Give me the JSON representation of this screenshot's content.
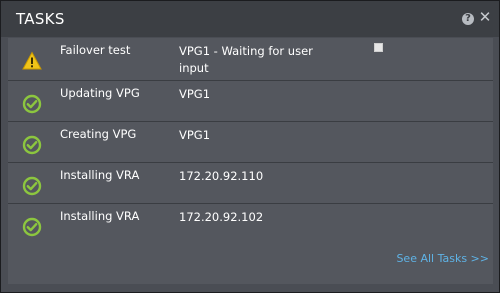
{
  "header": {
    "title": "TASKS",
    "help_icon": "?",
    "close_icon": "✕"
  },
  "tasks": [
    {
      "name": "Failover test",
      "target": "VPG1 - Waiting for user input",
      "status": "warning",
      "has_checkbox": true
    },
    {
      "name": "Updating VPG",
      "target": "VPG1",
      "status": "success"
    },
    {
      "name": "Creating VPG",
      "target": "VPG1",
      "status": "success"
    },
    {
      "name": "Installing VRA",
      "target": "172.20.92.110",
      "status": "success"
    },
    {
      "name": "Installing VRA",
      "target": "172.20.92.102",
      "status": "success"
    }
  ],
  "footer": {
    "see_all_label": "See All Tasks >>"
  },
  "colors": {
    "warning": "#f0c419",
    "success": "#8cc63f",
    "link": "#5fb3e6"
  }
}
